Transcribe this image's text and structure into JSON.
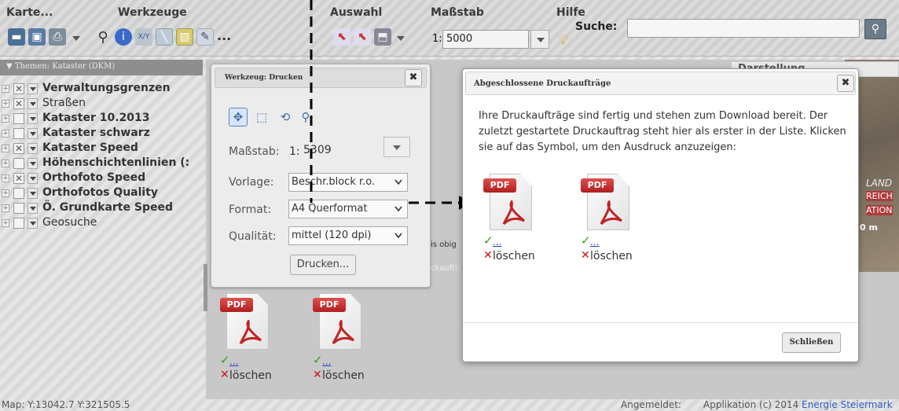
{
  "menu": {
    "karte": "Karte...",
    "werkzeuge": "Werkzeuge",
    "auswahl": "Auswahl",
    "massstab": "Maßstab",
    "hilfe": "Hilfe"
  },
  "toolbar": {
    "more_dots": "...",
    "scale_prefix": "1:",
    "scale_value": "5000",
    "search_label": "Suche:",
    "search_value": ""
  },
  "themes": {
    "header": "▼ Themen: Kataster (DKM)",
    "items": [
      {
        "label": "Verwaltungsgrenzen",
        "checked": true,
        "bold": true
      },
      {
        "label": "Straßen",
        "checked": true,
        "bold": false
      },
      {
        "label": "Kataster 10.2013",
        "checked": false,
        "bold": true
      },
      {
        "label": "Kataster schwarz",
        "checked": false,
        "bold": true
      },
      {
        "label": "Kataster Speed",
        "checked": true,
        "bold": true
      },
      {
        "label": "Höhenschichtenlinien (:",
        "checked": false,
        "bold": true
      },
      {
        "label": "Orthofoto Speed",
        "checked": true,
        "bold": true
      },
      {
        "label": "Orthofotos Quality",
        "checked": false,
        "bold": true
      },
      {
        "label": "Ö. Grundkarte Speed",
        "checked": false,
        "bold": true
      },
      {
        "label": "Geosuche",
        "checked": false,
        "bold": false
      }
    ]
  },
  "tool_window": {
    "title": "Werkzeug: Drucken",
    "close": "✖",
    "massstab_label": "Maßstab:",
    "massstab_prefix": "1:",
    "massstab_value": "5309",
    "vorlage_label": "Vorlage:",
    "vorlage_value": "Beschr.block r.o.",
    "format_label": "Format:",
    "format_value": "A4 Querformat",
    "qualitaet_label": "Qualität:",
    "qualitaet_value": "mittel (120 dpi)",
    "drucken_button": "Drucken...",
    "jobs": [
      {
        "badge": "PDF",
        "link": "...",
        "delete_x": "✕",
        "delete_label": "löschen"
      },
      {
        "badge": "PDF",
        "link": "...",
        "delete_x": "✕",
        "delete_label": "löschen"
      }
    ]
  },
  "dialog": {
    "title": "Abgeschlossene Druckaufträge",
    "close": "✖",
    "message": "Ihre Druckaufträge sind fertig und stehen zum Download bereit. Der zuletzt gestartete Druckauftrag steht hier als erster in der Liste. Klicken sie auf das Symbol, um den Ausdruck anzuzeigen:",
    "jobs": [
      {
        "badge": "PDF",
        "link": "...",
        "delete_x": "✕",
        "delete_label": "löschen"
      },
      {
        "badge": "PDF",
        "link": "...",
        "delete_x": "✕",
        "delete_label": "löschen"
      }
    ],
    "close_button": "Schließen"
  },
  "map": {
    "darstellung": "Darstellung",
    "land_label": "LAND",
    "reich_label": "REICH",
    "ation_label": "ATION",
    "distance_label": "0 m",
    "obig_text": "is obig",
    "auftr_text": "ckaufti"
  },
  "status": {
    "coords": "Map: Y:13042.7 Y:321505.5",
    "login": "Angemeldet:",
    "copyright": "Applikation (c) 2014",
    "link": "Energie Steiermark"
  },
  "colors": {
    "accent_blue": "#3a6fb0",
    "pdf_red": "#c02525",
    "delete_red": "#d01010",
    "check_green": "#3c9a1f"
  }
}
